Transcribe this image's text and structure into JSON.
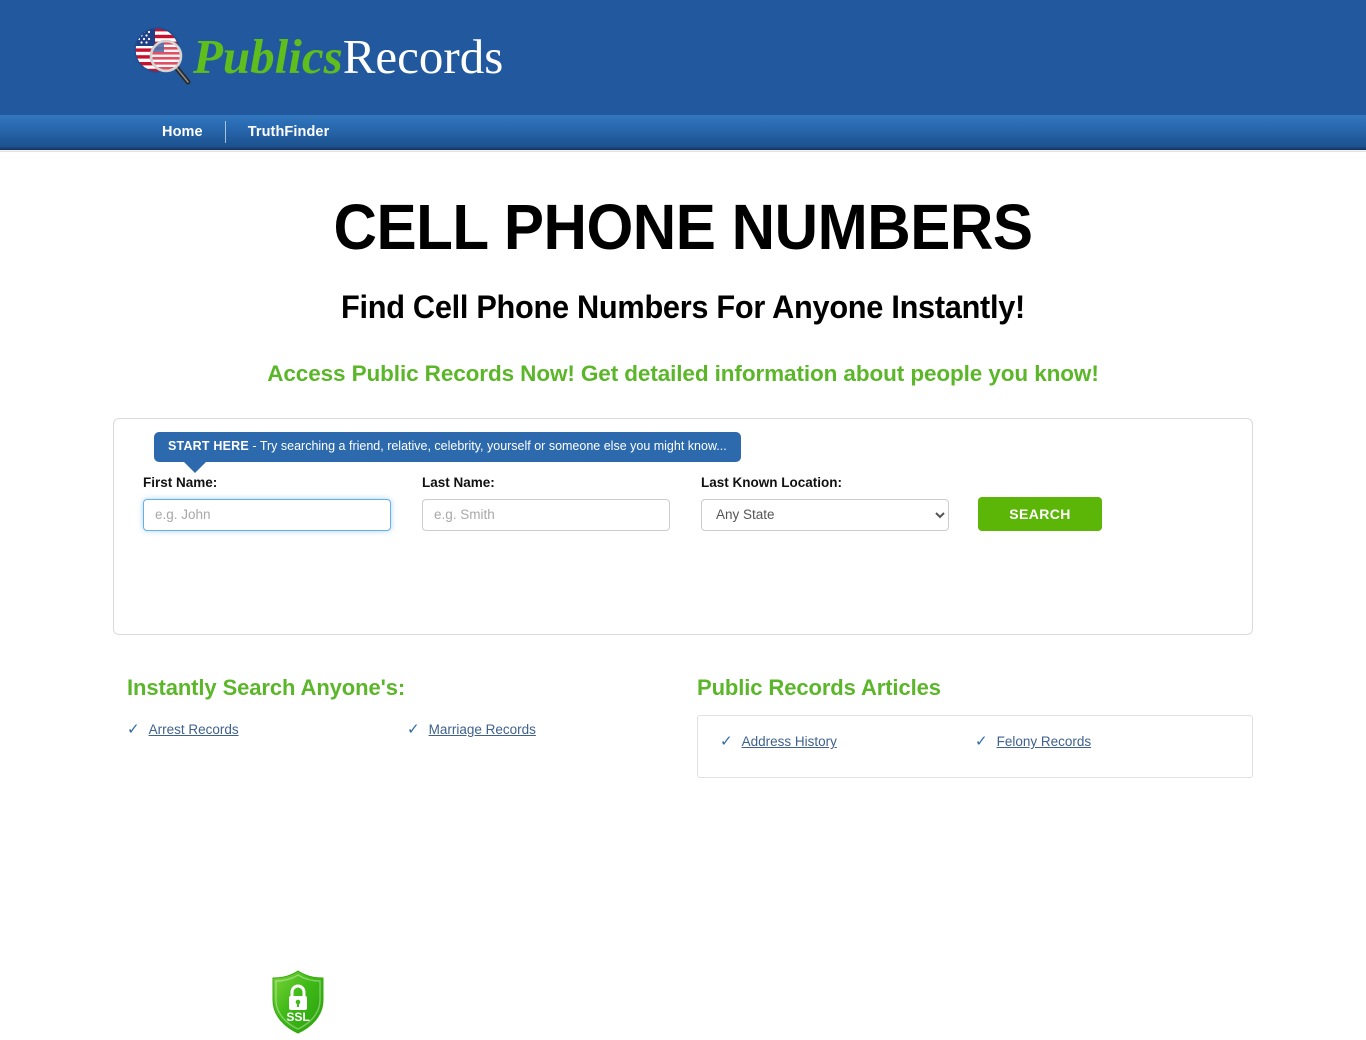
{
  "header": {
    "logo": {
      "icon": "magnifier-flag-icon",
      "text_green": "Publics",
      "text_white": "Records"
    },
    "background_color": "#22599e"
  },
  "nav": {
    "items": [
      {
        "label": "Home",
        "name": "nav-item-home"
      },
      {
        "label": "TruthFinder",
        "name": "nav-item-truthfinder"
      }
    ]
  },
  "hero": {
    "title": "CELL PHONE NUMBERS",
    "subtitle": "Find Cell Phone Numbers For Anyone Instantly!",
    "tagline": "Access Public Records Now! Get detailed information about people you know!",
    "tagline_color": "#5cb62a"
  },
  "search": {
    "tooltip_strong": "START HERE",
    "tooltip_rest": " - Try searching a friend, relative, celebrity, yourself or someone else you might know...",
    "tooltip_color": "#2c6aad",
    "first_name": {
      "label": "First Name:",
      "placeholder": "e.g. John",
      "value": ""
    },
    "last_name": {
      "label": "Last Name:",
      "placeholder": "e.g. Smith",
      "value": ""
    },
    "location": {
      "label": "Last Known Location:",
      "selected": "Any State",
      "options": [
        "Any State"
      ]
    },
    "submit_label": "SEARCH",
    "submit_color": "#5cb608",
    "ssl_badge": {
      "icon": "ssl-shield-lock-icon",
      "text": "SSL",
      "color": "#4cbb17"
    }
  },
  "instantly_search": {
    "title": "Instantly Search Anyone's:",
    "links": [
      {
        "label": "Arrest Records"
      },
      {
        "label": "Marriage Records"
      }
    ]
  },
  "articles": {
    "title": "Public Records Articles",
    "links": [
      {
        "label": "Address History"
      },
      {
        "label": "Felony Records"
      }
    ]
  }
}
